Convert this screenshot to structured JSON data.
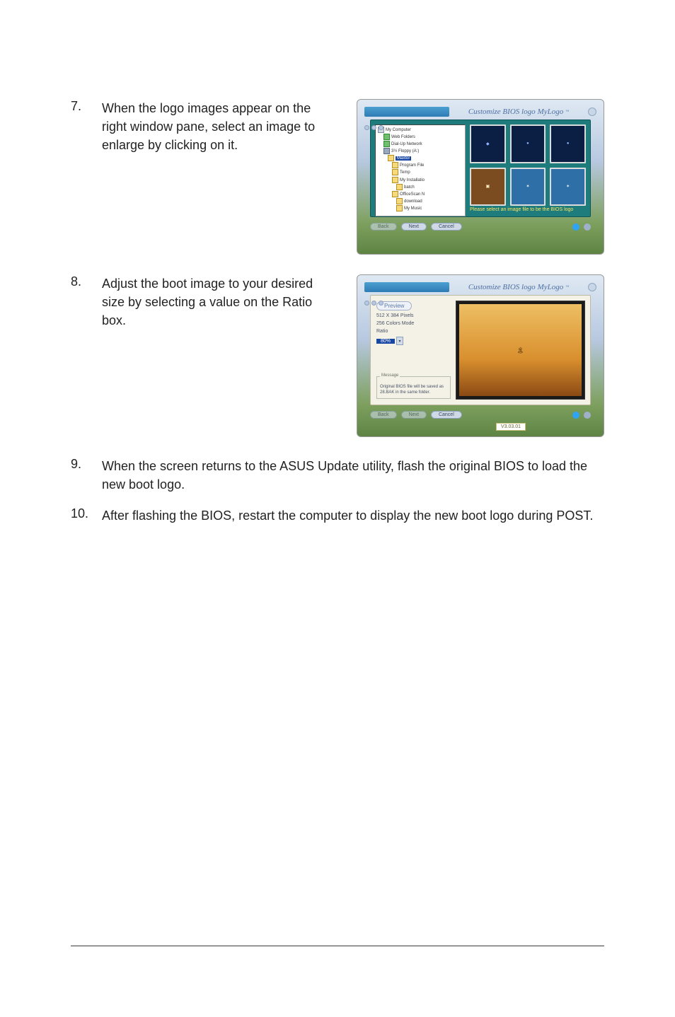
{
  "steps": {
    "s7": {
      "num": "7.",
      "text": "When the logo images appear on the right window pane, select an image to enlarge by clicking on it."
    },
    "s8": {
      "num": "8.",
      "text": "Adjust the boot image to your desired size by selecting a value on the Ratio box."
    },
    "s9": {
      "num": "9.",
      "text": "When the screen returns to the ASUS Update utility, flash the original BIOS to load the new boot logo."
    },
    "s10": {
      "num": "10.",
      "text": "After flashing the BIOS, restart the computer to display the new boot logo during POST."
    }
  },
  "fig1": {
    "brand_prefix": "Customize BIOS logo",
    "brand": "MyLogo",
    "tm": "™",
    "tree": {
      "root": "My Computer",
      "items": [
        "Web Folders",
        "Dial-Up Network",
        "3½ Floppy (A:)",
        "Maxtor",
        "Program File",
        "Temp",
        "My Installatio",
        "batch",
        "OfficeScan N",
        "download",
        "My Music"
      ],
      "selected": "Maxtor"
    },
    "hint": "Please select an image file to be the BIOS logo",
    "buttons": {
      "back": "Back",
      "next": "Next",
      "cancel": "Cancel"
    }
  },
  "fig2": {
    "brand_prefix": "Customize BIOS logo",
    "brand": "MyLogo",
    "tm": "™",
    "preview_tab": "Preview",
    "dims": "512 X 384 Pixels",
    "colors": "256 Colors Mode",
    "ratio_label": "Ratio",
    "ratio_value": "80%",
    "message_legend": "Message",
    "message": "Original BIOS file will be saved as 28.BAK in the same folder.",
    "version": "V3.03.01",
    "buttons": {
      "back": "Back",
      "next": "Next",
      "cancel": "Cancel"
    }
  }
}
